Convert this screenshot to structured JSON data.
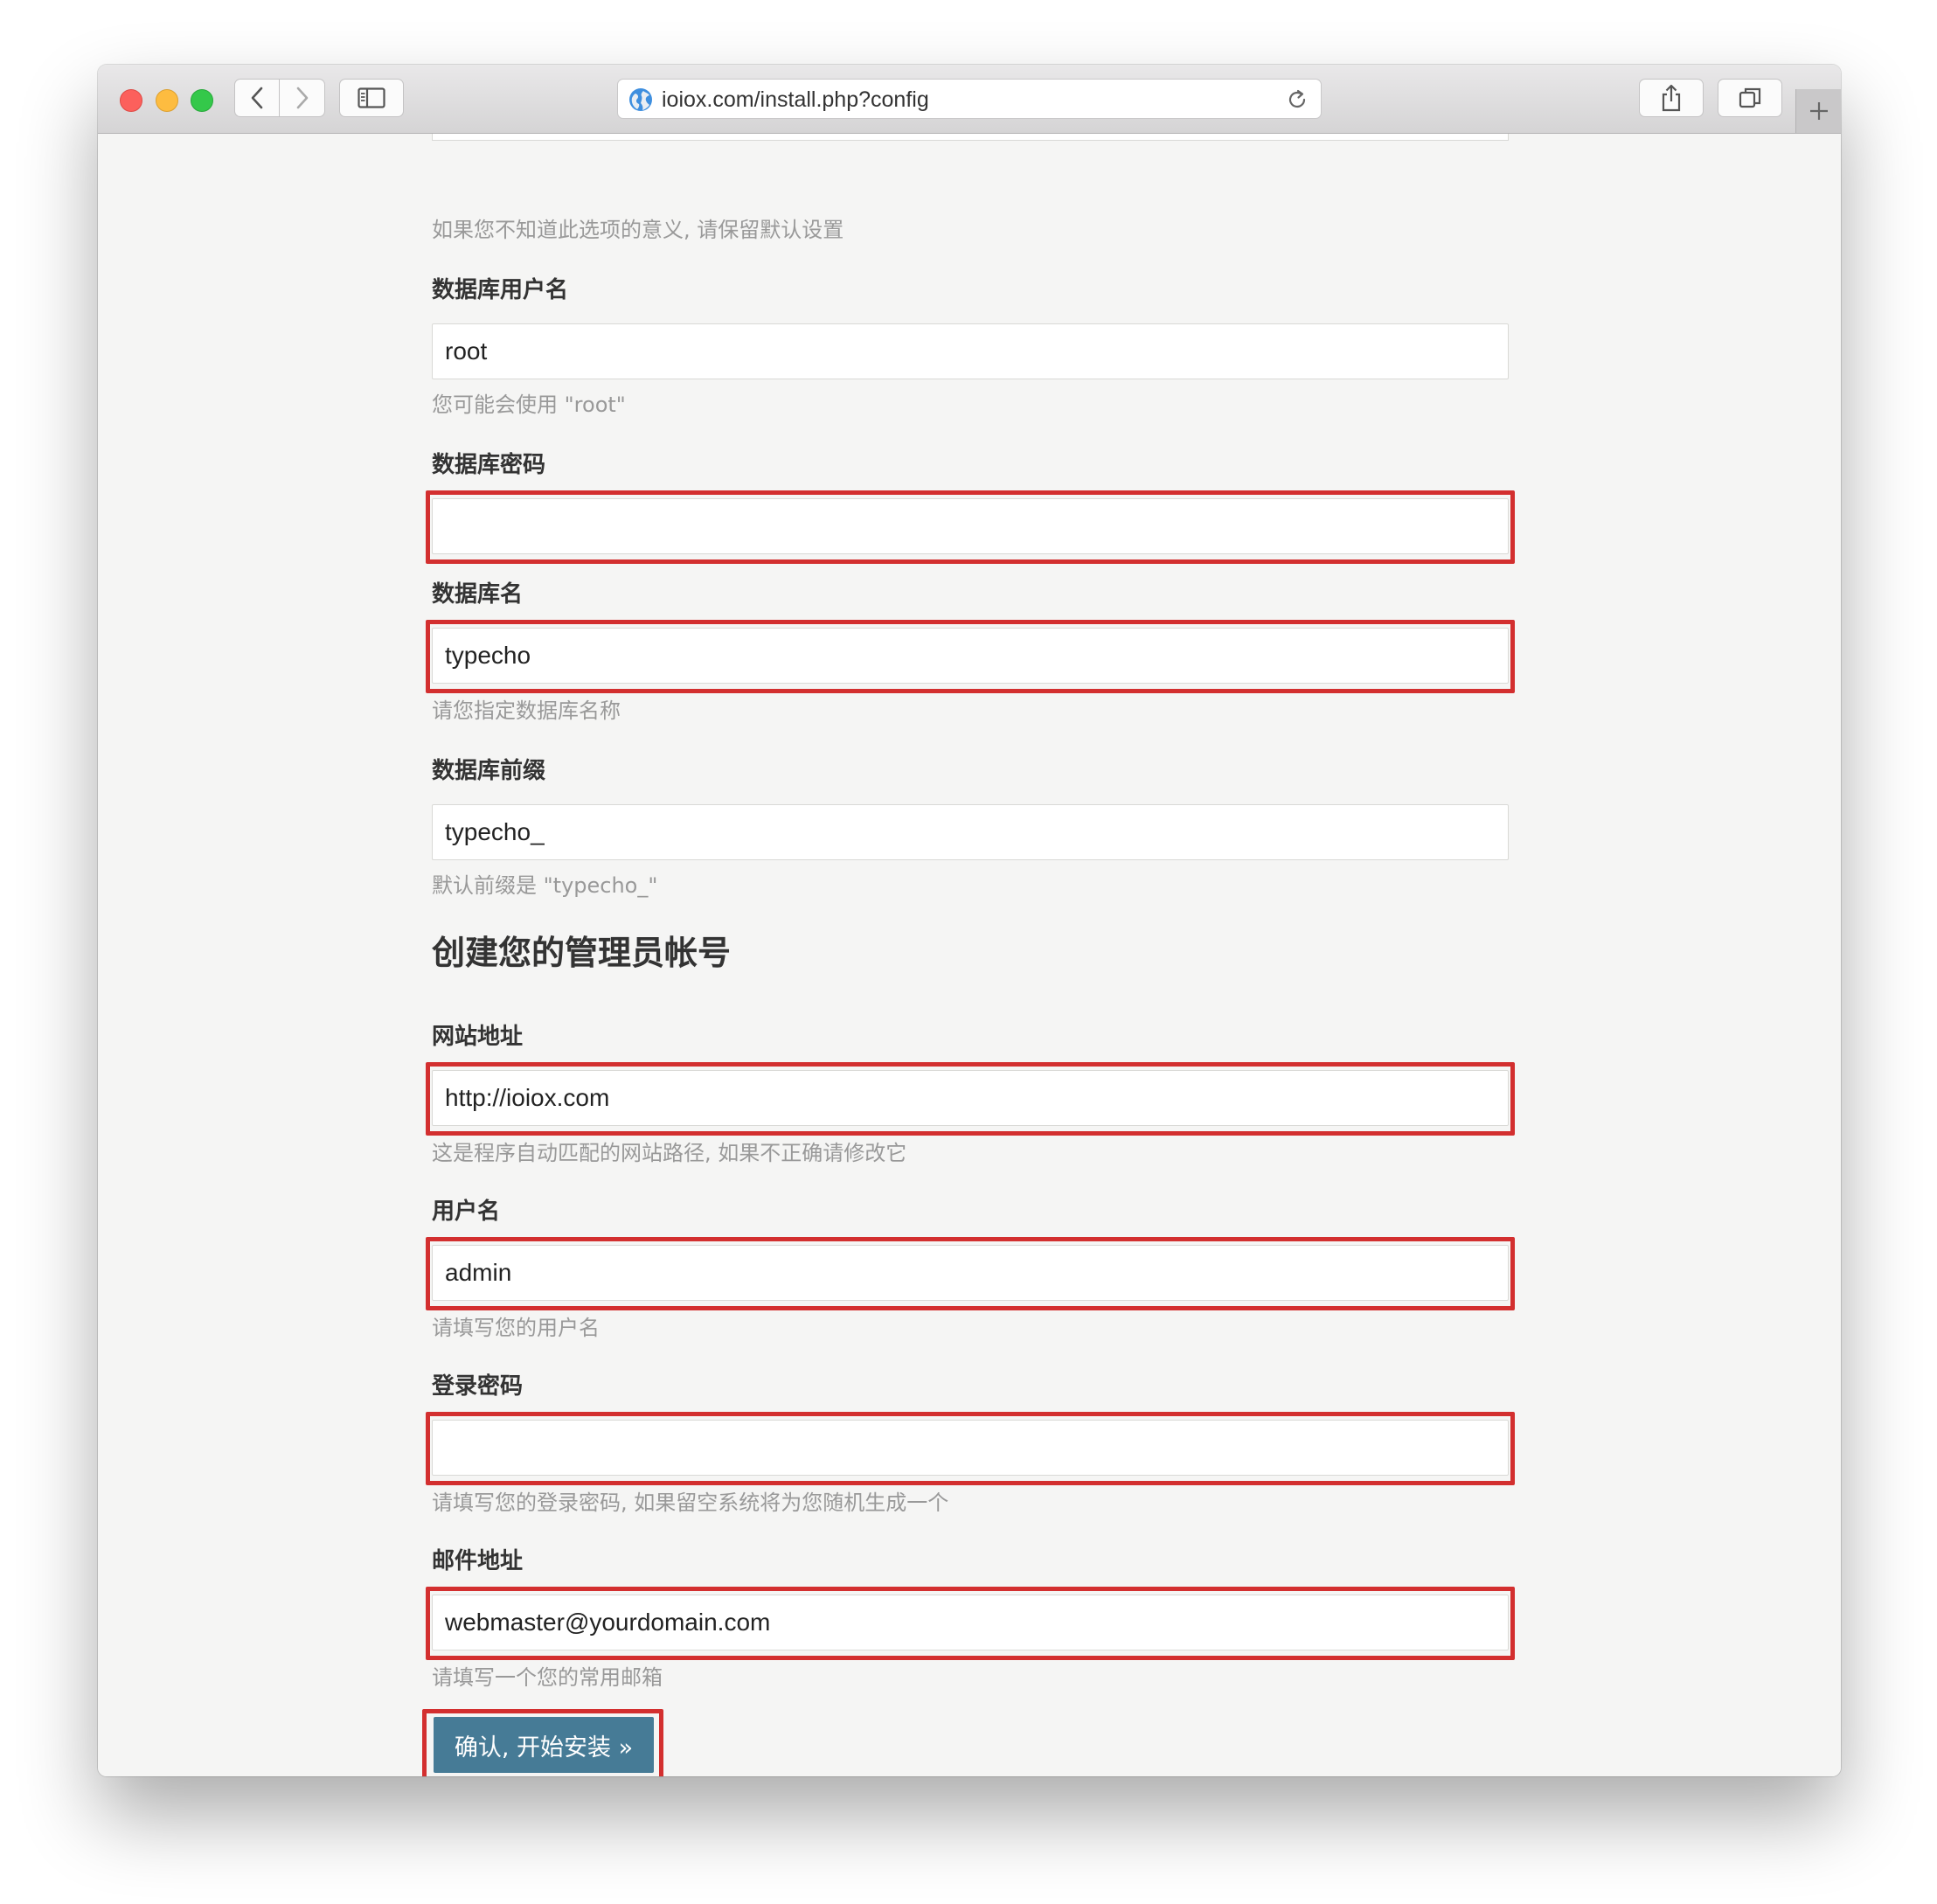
{
  "browser": {
    "url": "ioiox.com/install.php?config"
  },
  "form": {
    "prev_hint": "如果您不知道此选项的意义, 请保留默认设置",
    "db_user": {
      "label": "数据库用户名",
      "value": "root",
      "hint": "您可能会使用 \"root\""
    },
    "db_password": {
      "label": "数据库密码",
      "value": ""
    },
    "db_name": {
      "label": "数据库名",
      "value": "typecho",
      "hint": "请您指定数据库名称"
    },
    "db_prefix": {
      "label": "数据库前缀",
      "value": "typecho_",
      "hint": "默认前缀是 \"typecho_\""
    },
    "section_title": "创建您的管理员帐号",
    "site_url": {
      "label": "网站地址",
      "value": "http://ioiox.com",
      "hint": "这是程序自动匹配的网站路径, 如果不正确请修改它"
    },
    "username": {
      "label": "用户名",
      "value": "admin",
      "hint": "请填写您的用户名"
    },
    "login_password": {
      "label": "登录密码",
      "value": "",
      "hint": "请填写您的登录密码, 如果留空系统将为您随机生成一个"
    },
    "email": {
      "label": "邮件地址",
      "value": "webmaster@yourdomain.com",
      "hint": "请填写一个您的常用邮箱"
    },
    "submit_label": "确认, 开始安装 »"
  },
  "colors": {
    "highlight": "#d32f2f",
    "button": "#467b96"
  }
}
